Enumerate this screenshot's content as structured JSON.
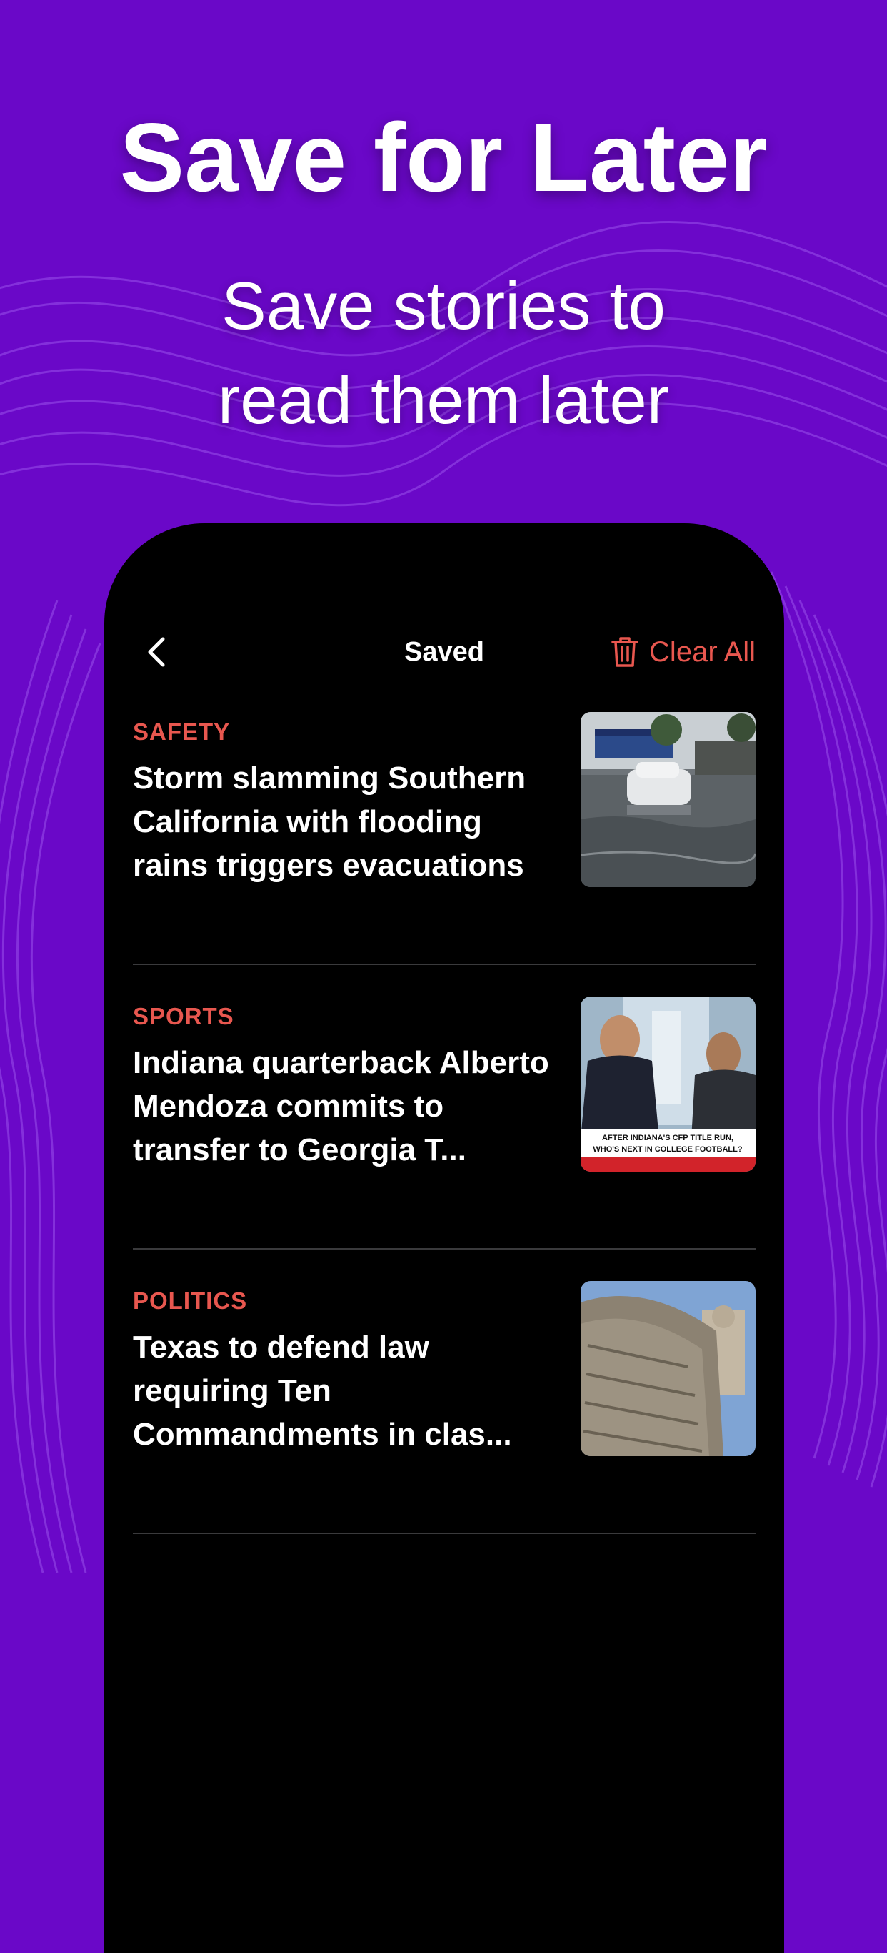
{
  "hero": {
    "title": "Save for Later",
    "subtitle_line1": "Save stories to",
    "subtitle_line2": "read them later"
  },
  "nav": {
    "title": "Saved",
    "clear_label": "Clear All",
    "back_icon": "chevron-left-icon",
    "clear_icon": "trash-icon"
  },
  "articles": [
    {
      "category": "SAFETY",
      "headline": "Storm slamming Southern California with flooding rains triggers evacuations",
      "image": "flooded-street-photo"
    },
    {
      "category": "SPORTS",
      "headline": "Indiana quarterback Alberto Mendoza commits to transfer to Georgia T...",
      "image": "sports-show-photo",
      "image_caption_line1": "AFTER INDIANA'S CFP TITLE RUN,",
      "image_caption_line2": "WHO'S NEXT IN COLLEGE FOOTBALL?"
    },
    {
      "category": "POLITICS",
      "headline": "Texas to defend law requiring Ten Commandments in clas...",
      "image": "ten-commandments-monument-photo"
    }
  ],
  "colors": {
    "background": "#6a08c8",
    "accent": "#e8574f",
    "phone": "#000000",
    "divider": "#3a3a3c"
  }
}
